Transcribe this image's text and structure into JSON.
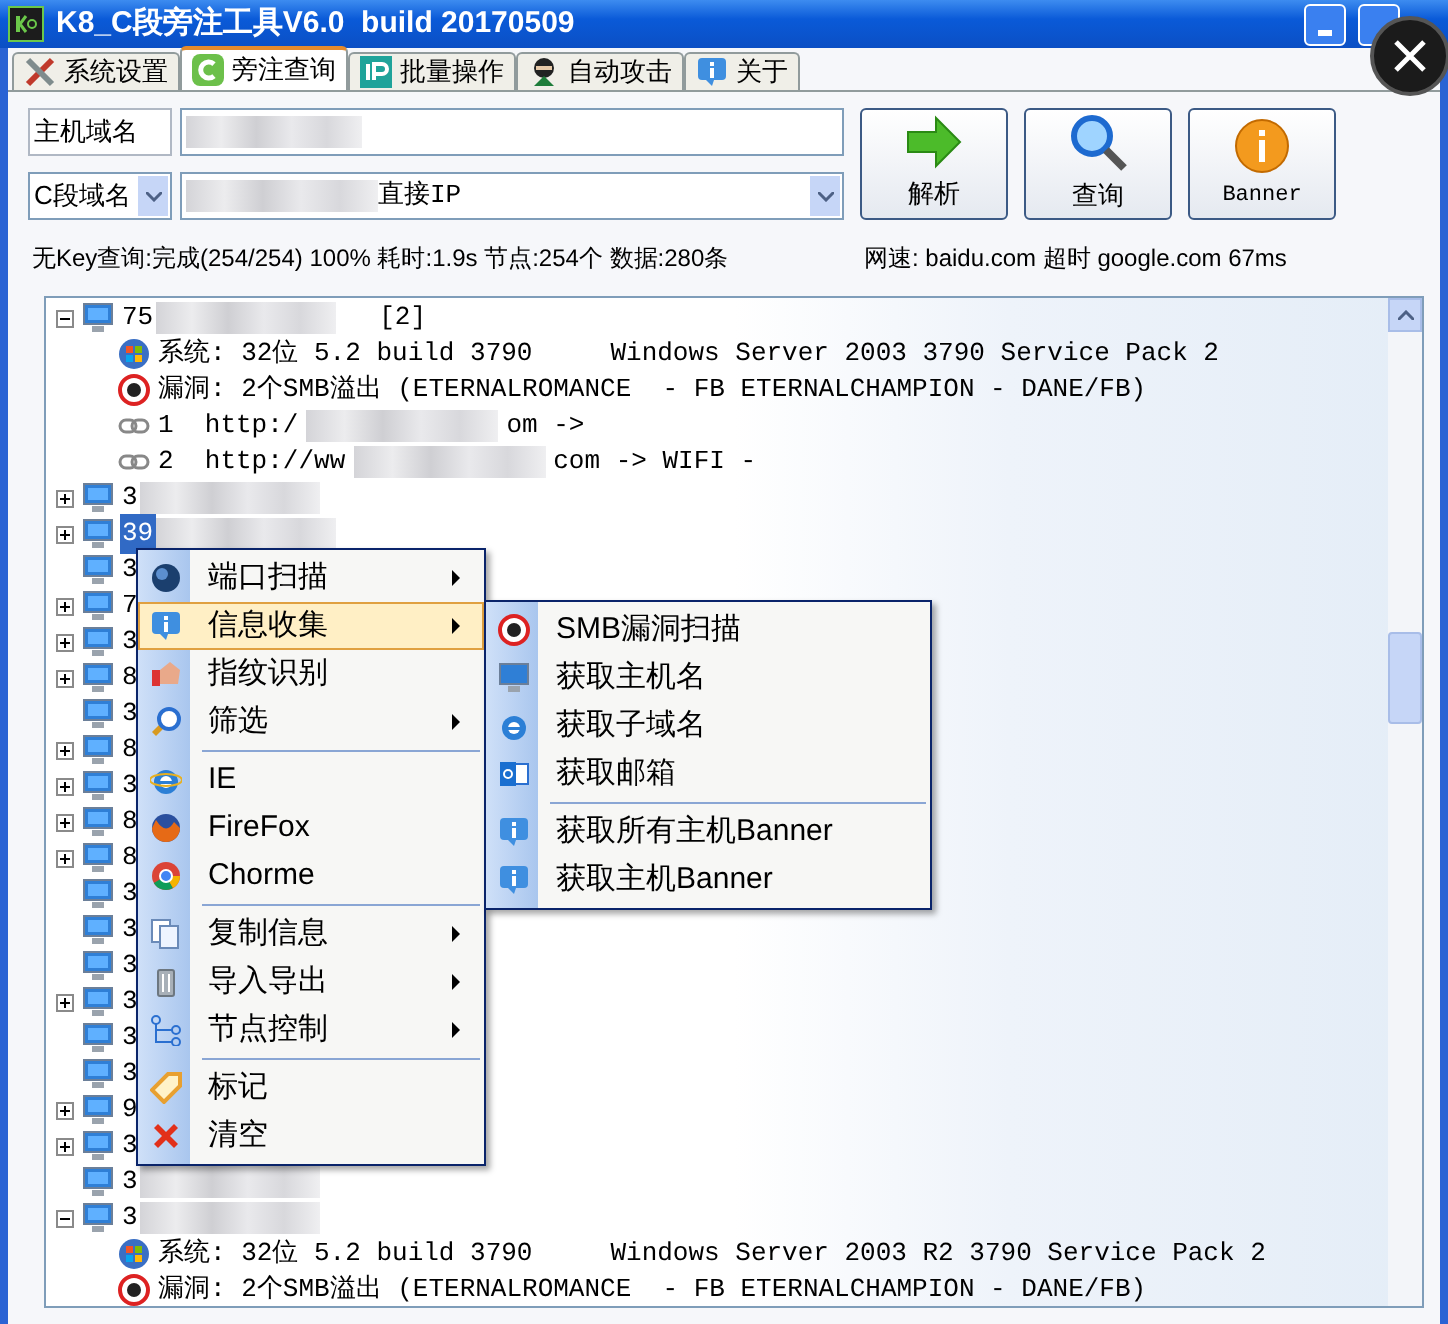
{
  "window": {
    "title": "K8_C段旁注工具V6.0  build 20170509"
  },
  "tabs": [
    {
      "label": "系统设置",
      "selected": false
    },
    {
      "label": "旁注查询",
      "selected": true
    },
    {
      "label": "批量操作",
      "selected": false
    },
    {
      "label": "自动攻击",
      "selected": false
    },
    {
      "label": "关于",
      "selected": false
    }
  ],
  "form": {
    "host_label": "主机域名",
    "segment_label": "C段域名",
    "segment_value": "直接IP",
    "buttons": [
      "解析",
      "查询",
      "Banner"
    ]
  },
  "status": {
    "query": "无Key查询:完成(254/254) 100% 耗时:1.9s 节点:254个 数据:280条",
    "network": "网速: baidu.com 超时 google.com 67ms"
  },
  "tree": [
    {
      "label": "75",
      "suffix": "[2]",
      "expandable": true,
      "expanded": true,
      "selected": false,
      "children": [
        {
          "kind": "system",
          "text": "系统: 32位 5.2 build 3790     Windows Server 2003 3790 Service Pack 2"
        },
        {
          "kind": "vuln",
          "text": "漏洞: 2个SMB溢出 (ETERNALROMANCE  - FB ETERNALCHAMPION - DANE/FB)"
        },
        {
          "kind": "link",
          "text": "1  http:/",
          "tail": "om ->"
        },
        {
          "kind": "link",
          "text": "2  http://ww",
          "tail": "com -> WIFI -"
        }
      ]
    },
    {
      "label": "3",
      "expandable": true,
      "expanded": false,
      "selected": false
    },
    {
      "label": "39",
      "expandable": true,
      "expanded": false,
      "selected": true
    },
    {
      "label": "3",
      "expandable": false,
      "selected": false
    },
    {
      "label": "7",
      "expandable": true,
      "expanded": false,
      "selected": false
    },
    {
      "label": "3",
      "expandable": true,
      "expanded": false,
      "selected": false
    },
    {
      "label": "8",
      "expandable": true,
      "expanded": false,
      "selected": false
    },
    {
      "label": "3",
      "expandable": false,
      "selected": false
    },
    {
      "label": "8",
      "expandable": true,
      "expanded": false,
      "selected": false
    },
    {
      "label": "3",
      "expandable": true,
      "expanded": false,
      "selected": false
    },
    {
      "label": "8",
      "expandable": true,
      "expanded": false,
      "selected": false
    },
    {
      "label": "8",
      "expandable": true,
      "expanded": false,
      "selected": false
    },
    {
      "label": "3",
      "expandable": false,
      "selected": false
    },
    {
      "label": "3",
      "expandable": false,
      "selected": false
    },
    {
      "label": "3",
      "expandable": false,
      "selected": false
    },
    {
      "label": "3",
      "expandable": true,
      "expanded": false,
      "selected": false
    },
    {
      "label": "3",
      "expandable": false,
      "selected": false
    },
    {
      "label": "3",
      "expandable": false,
      "selected": false
    },
    {
      "label": "9",
      "expandable": true,
      "expanded": false,
      "selected": false
    },
    {
      "label": "3",
      "expandable": true,
      "expanded": false,
      "selected": false
    },
    {
      "label": "3",
      "expandable": false,
      "selected": false
    },
    {
      "label": "3",
      "expandable": true,
      "expanded": true,
      "selected": false,
      "children": [
        {
          "kind": "system",
          "text": "系统: 32位 5.2 build 3790     Windows Server 2003 R2 3790 Service Pack 2"
        },
        {
          "kind": "vuln",
          "text": "漏洞: 2个SMB溢出 (ETERNALROMANCE  - FB ETERNALCHAMPION - DANE/FB)"
        }
      ]
    }
  ],
  "context_menu": [
    {
      "kind": "item",
      "label": "端口扫描",
      "submenu": true,
      "selected": false
    },
    {
      "kind": "item",
      "label": "信息收集",
      "submenu": true,
      "selected": true
    },
    {
      "kind": "item",
      "label": "指纹识别",
      "submenu": false,
      "selected": false
    },
    {
      "kind": "item",
      "label": "筛选",
      "submenu": true,
      "selected": false
    },
    {
      "kind": "separator"
    },
    {
      "kind": "item",
      "label": "IE",
      "submenu": false,
      "selected": false
    },
    {
      "kind": "item",
      "label": "FireFox",
      "submenu": false,
      "selected": false
    },
    {
      "kind": "item",
      "label": "Chorme",
      "submenu": false,
      "selected": false
    },
    {
      "kind": "separator"
    },
    {
      "kind": "item",
      "label": "复制信息",
      "submenu": true,
      "selected": false
    },
    {
      "kind": "item",
      "label": "导入导出",
      "submenu": true,
      "selected": false
    },
    {
      "kind": "item",
      "label": "节点控制",
      "submenu": true,
      "selected": false
    },
    {
      "kind": "separator"
    },
    {
      "kind": "item",
      "label": "标记",
      "submenu": false,
      "selected": false
    },
    {
      "kind": "item",
      "label": "清空",
      "submenu": false,
      "selected": false
    }
  ],
  "submenu": [
    {
      "kind": "item",
      "label": "SMB漏洞扫描"
    },
    {
      "kind": "item",
      "label": "获取主机名"
    },
    {
      "kind": "item",
      "label": "获取子域名"
    },
    {
      "kind": "item",
      "label": "获取邮箱"
    },
    {
      "kind": "separator"
    },
    {
      "kind": "item",
      "label": "获取所有主机Banner"
    },
    {
      "kind": "item",
      "label": "获取主机Banner"
    }
  ]
}
